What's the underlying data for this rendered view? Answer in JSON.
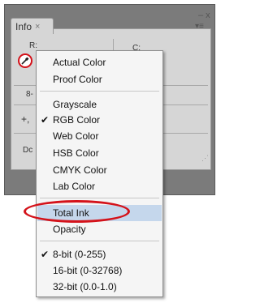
{
  "panel": {
    "tab_title": "Info",
    "tab_close": "×",
    "window_close": "– x",
    "menu_button": "▾≡",
    "labels": {
      "r": "R:",
      "c": "C:",
      "bit": "8-",
      "plus": "+,",
      "doc": "Dc"
    }
  },
  "menu": {
    "group1": [
      "Actual Color",
      "Proof Color"
    ],
    "group2": [
      "Grayscale",
      "RGB Color",
      "Web Color",
      "HSB Color",
      "CMYK Color",
      "Lab Color"
    ],
    "group3": [
      "Total Ink",
      "Opacity"
    ],
    "group4": [
      "8-bit (0-255)",
      "16-bit (0-32768)",
      "32-bit (0.0-1.0)"
    ],
    "check_mark": "✔"
  }
}
